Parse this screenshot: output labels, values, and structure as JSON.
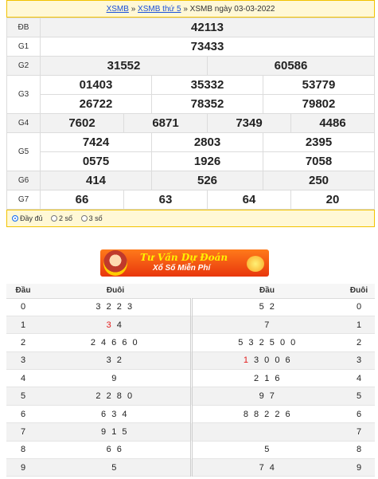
{
  "breadcrumb": {
    "link1": "XSMB",
    "sep1": " » ",
    "link2": "XSMB thứ 5",
    "sep2": " » ",
    "current": "XSMB ngày 03-03-2022"
  },
  "results": {
    "db": {
      "label": "ĐB",
      "nums": [
        "42113"
      ]
    },
    "g1": {
      "label": "G1",
      "nums": [
        "73433"
      ]
    },
    "g2": {
      "label": "G2",
      "nums": [
        "31552",
        "60586"
      ]
    },
    "g3": {
      "label": "G3",
      "row1": [
        "01403",
        "35332",
        "53779"
      ],
      "row2": [
        "26722",
        "78352",
        "79802"
      ]
    },
    "g4": {
      "label": "G4",
      "nums": [
        "7602",
        "6871",
        "7349",
        "4486"
      ]
    },
    "g5": {
      "label": "G5",
      "row1": [
        "7424",
        "2803",
        "2395"
      ],
      "row2": [
        "0575",
        "1926",
        "7058"
      ]
    },
    "g6": {
      "label": "G6",
      "nums": [
        "414",
        "526",
        "250"
      ]
    },
    "g7": {
      "label": "G7",
      "nums": [
        "66",
        "63",
        "64",
        "20"
      ]
    }
  },
  "options": {
    "full": "Đầy đủ",
    "two": "2 số",
    "three": "3 số",
    "selected": "full"
  },
  "banner": {
    "line1": "Tư Vấn Dự Đoán",
    "line2": "Xổ Số Miễn Phí"
  },
  "loto": {
    "headers": {
      "dau": "Đầu",
      "duoi": "Đuôi",
      "dau2": "Đầu",
      "duoi2": "Đuôi"
    },
    "rows": [
      {
        "dau": "0",
        "duoi": "3 2 2 3",
        "dau2": "5 2",
        "duoi2": "0"
      },
      {
        "dau": "1",
        "duoi_red": "3",
        "duoi": " 4",
        "dau2": "7",
        "duoi2": "1"
      },
      {
        "dau": "2",
        "duoi": "2 4 6 6 0",
        "dau2": "5 3 2 5 0 0",
        "duoi2": "2"
      },
      {
        "dau": "3",
        "duoi": "3 2",
        "dau2_red": "1",
        "dau2": " 3 0 0 6",
        "duoi2": "3"
      },
      {
        "dau": "4",
        "duoi": "9",
        "dau2": "2 1 6",
        "duoi2": "4"
      },
      {
        "dau": "5",
        "duoi": "2 2 8 0",
        "dau2": "9 7",
        "duoi2": "5"
      },
      {
        "dau": "6",
        "duoi": "6 3 4",
        "dau2": "8 8 2 2 6",
        "duoi2": "6"
      },
      {
        "dau": "7",
        "duoi": "9 1 5",
        "dau2": "",
        "duoi2": "7"
      },
      {
        "dau": "8",
        "duoi": "6 6",
        "dau2": "5",
        "duoi2": "8"
      },
      {
        "dau": "9",
        "duoi": "5",
        "dau2": "7 4",
        "duoi2": "9"
      }
    ]
  }
}
